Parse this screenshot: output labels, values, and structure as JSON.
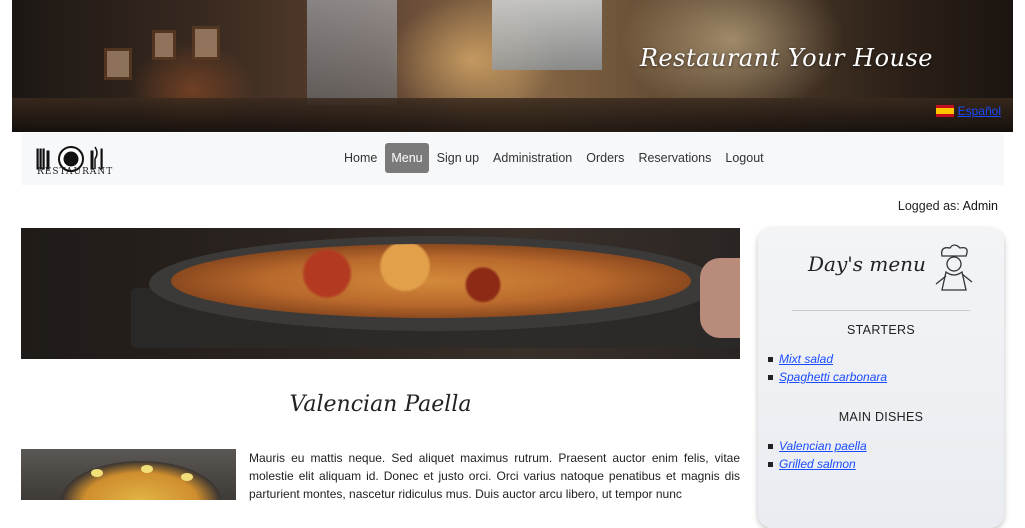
{
  "header": {
    "title": "Restaurant Your House",
    "language_link": "Español"
  },
  "brand": {
    "logo_text": "RESTAURANT"
  },
  "nav": {
    "items": [
      {
        "label": "Home",
        "active": false
      },
      {
        "label": "Menu",
        "active": true
      },
      {
        "label": "Sign up",
        "active": false
      },
      {
        "label": "Administration",
        "active": false
      },
      {
        "label": "Orders",
        "active": false
      },
      {
        "label": "Reservations",
        "active": false
      },
      {
        "label": "Logout",
        "active": false
      }
    ]
  },
  "session": {
    "label": "Logged as:",
    "user": "Admin"
  },
  "main": {
    "dish_title": "Valencian Paella",
    "description": "Mauris eu mattis neque. Sed aliquet maximus rutrum. Praesent auctor enim felis, vitae molestie elit aliquam id. Donec et justo orci. Orci varius natoque penatibus et magnis dis parturient montes, nascetur ridiculus mus. Duis auctor arcu libero, ut tempor nunc"
  },
  "sidebar": {
    "title": "Day's menu",
    "sections": [
      {
        "heading": "STARTERS",
        "items": [
          "Mixt salad",
          "Spaghetti carbonara"
        ]
      },
      {
        "heading": "MAIN DISHES",
        "items": [
          "Valencian paella",
          "Grilled salmon"
        ]
      }
    ]
  },
  "colors": {
    "link": "#1a4cff",
    "nav_active_bg": "#7a7a7a",
    "navbar_bg": "#f7f8fa",
    "sidebar_bg": "#eceff3"
  }
}
